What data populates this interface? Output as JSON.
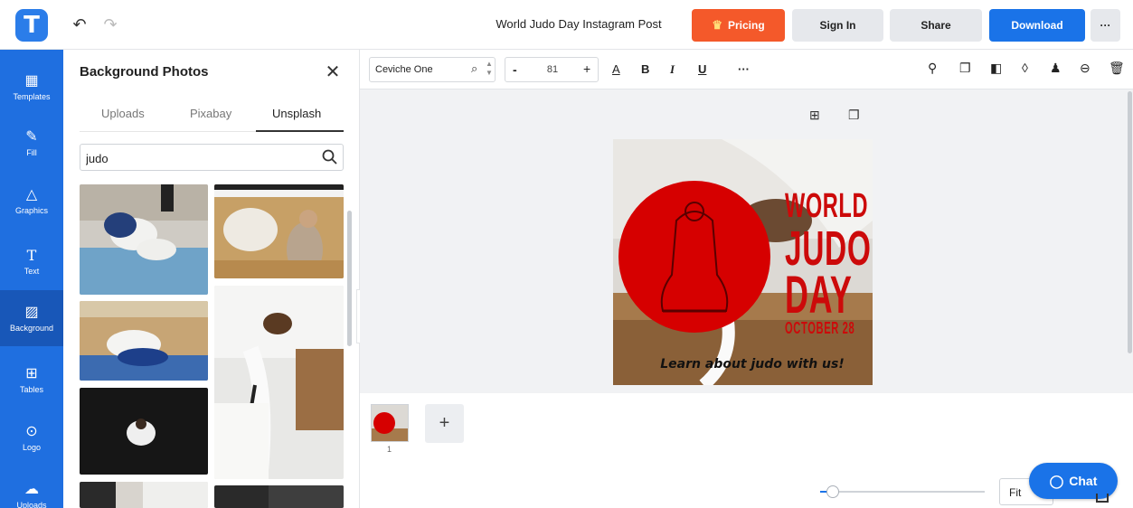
{
  "topbar": {
    "logo_letter": "T",
    "doc_title": "World Judo Day Instagram Post",
    "pricing_label": "Pricing",
    "signin_label": "Sign In",
    "share_label": "Share",
    "download_label": "Download",
    "more_label": "···",
    "accent_orange": "#f4592a",
    "accent_blue": "#1a73e8"
  },
  "rail": {
    "items": [
      {
        "label": "Templates",
        "icon": "templates-icon"
      },
      {
        "label": "Fill",
        "icon": "brush-icon"
      },
      {
        "label": "Graphics",
        "icon": "shapes-icon"
      },
      {
        "label": "Text",
        "icon": "text-icon"
      },
      {
        "label": "Background",
        "icon": "background-icon",
        "active": true
      },
      {
        "label": "Tables",
        "icon": "table-icon"
      },
      {
        "label": "Logo",
        "icon": "logo-icon"
      },
      {
        "label": "Uploads",
        "icon": "upload-cloud-icon"
      }
    ]
  },
  "panel": {
    "title": "Background Photos",
    "tabs": [
      "Uploads",
      "Pixabay",
      "Unsplash"
    ],
    "active_tab": "Unsplash",
    "search_value": "judo"
  },
  "toolbar": {
    "font_name": "Ceviche One",
    "font_size": "81",
    "size_minus": "-",
    "size_plus": "+",
    "bold": "B",
    "italic": "I",
    "underline": "U",
    "more": "···"
  },
  "poster": {
    "line1": "WORLD",
    "line2": "JUDO",
    "line3": "DAY",
    "line4": "OCTOBER 28",
    "tagline": "Learn about judo with us!",
    "accent_red": "#cc0a0a"
  },
  "pages": {
    "page_number": "1",
    "add_label": "+"
  },
  "zoom": {
    "fit_label": "Fit",
    "level_fraction": 0.08
  },
  "chat": {
    "label": "Chat"
  }
}
